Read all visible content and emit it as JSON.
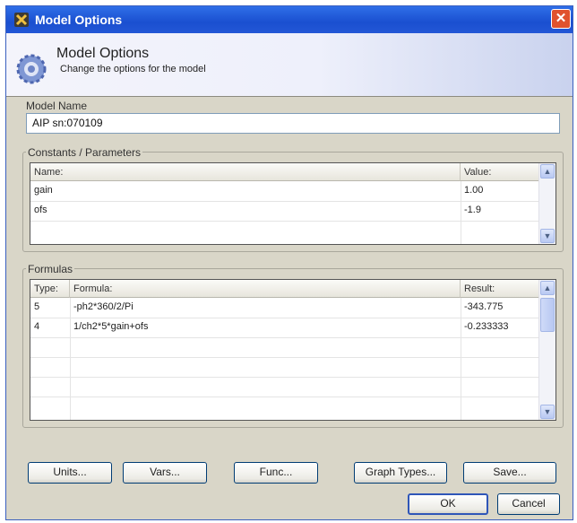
{
  "window": {
    "title": "Model Options",
    "close_glyph": "✕",
    "title_icon": "app-icon",
    "close_icon": "close-icon"
  },
  "banner": {
    "heading": "Model Options",
    "subtitle": "Change the options for the model",
    "icon": "gear-icon"
  },
  "model_name": {
    "label": "Model Name",
    "value": "AIP sn:070109"
  },
  "constants": {
    "group_label": "Constants / Parameters",
    "columns": [
      "Name:",
      "Value:"
    ],
    "rows": [
      {
        "name": "gain",
        "value": "1.00"
      },
      {
        "name": "ofs",
        "value": "-1.9"
      }
    ]
  },
  "formulas": {
    "group_label": "Formulas",
    "columns": [
      "Type:",
      "Formula:",
      "Result:"
    ],
    "rows": [
      {
        "type": "5",
        "formula": "-ph2*360/2/Pi",
        "result": "-343.775"
      },
      {
        "type": "4",
        "formula": "1/ch2*5*gain+ofs",
        "result": "-0.233333"
      }
    ]
  },
  "buttons": {
    "units": "Units...",
    "vars": "Vars...",
    "func": "Func...",
    "graph_types": "Graph Types...",
    "save": "Save...",
    "ok": "OK",
    "cancel": "Cancel"
  },
  "colors": {
    "titlebar": "#2357d6",
    "dialog": "#d9d6c8",
    "close": "#e0522e"
  }
}
